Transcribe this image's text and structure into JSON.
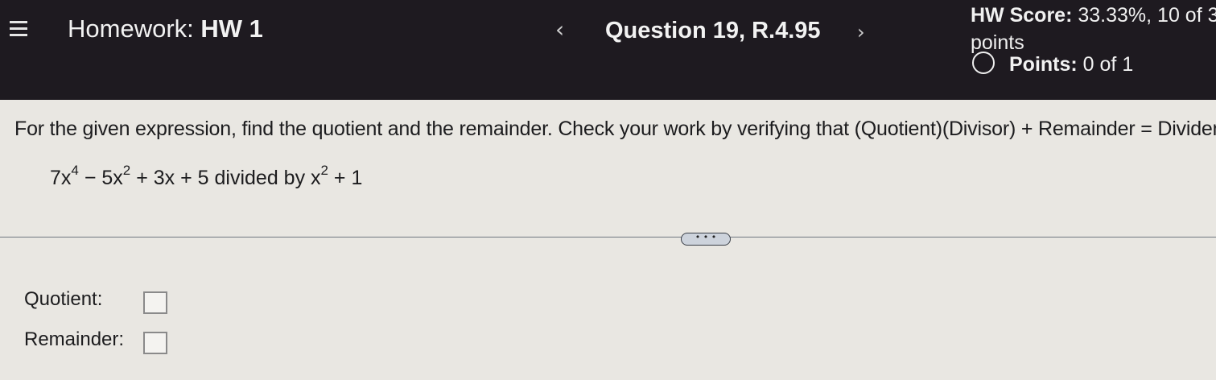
{
  "header": {
    "homework_label": "Homework:",
    "homework_name": "HW 1",
    "question_title": "Question 19, R.4.95",
    "prev_icon": "chevron-left-icon",
    "next_icon": "chevron-right-icon",
    "menu_icon": "hamburger-menu-icon",
    "score_label": "HW Score:",
    "score_value": "33.33%, 10 of 3",
    "score_suffix": "points",
    "points_label": "Points:",
    "points_value": "0 of 1"
  },
  "question": {
    "instructions": "For the given expression, find the quotient and the remainder.  Check your work by verifying that (Quotient)(Divisor) + Remainder = Dividend.",
    "dividend_term1": "7x",
    "dividend_exp1": "4",
    "dividend_term2": " − 5x",
    "dividend_exp2": "2",
    "dividend_rest": " + 3x + 5",
    "divided_by": " divided by ",
    "divisor_term": "x",
    "divisor_exp": "2",
    "divisor_rest": " + 1",
    "more_button": "• • •"
  },
  "answers": {
    "quotient_label": "Quotient:",
    "remainder_label": "Remainder:",
    "quotient_value": "",
    "remainder_value": ""
  },
  "colors": {
    "header_bg": "#1e1a20",
    "page_bg": "#e9e7e2",
    "text": "#1c1c1e"
  }
}
